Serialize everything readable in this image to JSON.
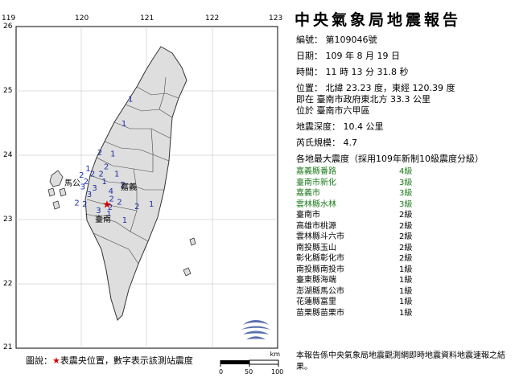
{
  "report": {
    "title": "中央氣象局地震報告",
    "number": "編號： 第109046號",
    "date": "日期： 109 年 8 月 19 日",
    "time": "時間： 11 時 13 分 31.8 秒",
    "position": "位置： 北緯 23.23 度，東經 120.39 度",
    "position_ref": "即在 臺南市政府東北方 33.3 公里",
    "position_district": "位於 臺南市六甲區",
    "depth": "地震深度： 10.4 公里",
    "magnitude": "芮氏規模： 4.7",
    "intensity_header": "各地最大震度（採用109年新制10級震度分級）"
  },
  "stations": [
    {
      "name": "嘉義縣番路",
      "level": "4級",
      "highlight": true
    },
    {
      "name": "臺南市新化",
      "level": "3級",
      "highlight": true
    },
    {
      "name": "嘉義市",
      "level": "3級",
      "highlight": true
    },
    {
      "name": "雲林縣水林",
      "level": "3級",
      "highlight": true
    },
    {
      "name": "臺南市",
      "level": "2級",
      "highlight": false
    },
    {
      "name": "高雄市桃源",
      "level": "2級",
      "highlight": false
    },
    {
      "name": "雲林縣斗六市",
      "level": "2級",
      "highlight": false
    },
    {
      "name": "南投縣玉山",
      "level": "2級",
      "highlight": false
    },
    {
      "name": "彰化縣彰化市",
      "level": "2級",
      "highlight": false
    },
    {
      "name": "南投縣南投市",
      "level": "1級",
      "highlight": false
    },
    {
      "name": "臺東縣海端",
      "level": "1級",
      "highlight": false
    },
    {
      "name": "澎湖縣馬公市",
      "level": "1級",
      "highlight": false
    },
    {
      "name": "花蓮縣富里",
      "level": "1級",
      "highlight": false
    },
    {
      "name": "苗栗縣苗栗市",
      "level": "1級",
      "highlight": false
    }
  ],
  "footer": "本報告係中央氣象局地震觀測網即時地震資料地震速報之結果。",
  "map": {
    "lon_ticks": [
      "119",
      "120",
      "121",
      "122",
      "123"
    ],
    "lat_ticks": [
      "26",
      "25",
      "24",
      "23",
      "22",
      "21"
    ],
    "legend_prefix": "圖說：",
    "legend_star": "★",
    "legend_suffix": "表震央位置，數字表示該測站震度",
    "scale_unit": "km",
    "scale_ticks": [
      "0",
      "50",
      "100"
    ],
    "epicenter": {
      "lon": 120.39,
      "lat": 23.23
    },
    "place_labels": [
      "馬公",
      "嘉義",
      "臺南"
    ],
    "intensity_marks": [
      {
        "v": "1",
        "lon": 120.75,
        "lat": 24.83
      },
      {
        "v": "1",
        "lon": 120.65,
        "lat": 24.45
      },
      {
        "v": "2",
        "lon": 120.28,
        "lat": 24.0
      },
      {
        "v": "1",
        "lon": 120.48,
        "lat": 23.98
      },
      {
        "v": "1",
        "lon": 120.1,
        "lat": 23.75
      },
      {
        "v": "2",
        "lon": 120.38,
        "lat": 23.78
      },
      {
        "v": "2",
        "lon": 120.0,
        "lat": 23.65
      },
      {
        "v": "2",
        "lon": 120.17,
        "lat": 23.67
      },
      {
        "v": "2",
        "lon": 120.3,
        "lat": 23.67
      },
      {
        "v": "1",
        "lon": 120.54,
        "lat": 23.67
      },
      {
        "v": "2",
        "lon": 120.07,
        "lat": 23.55
      },
      {
        "v": "1",
        "lon": 120.35,
        "lat": 23.55
      },
      {
        "v": "2",
        "lon": 120.63,
        "lat": 23.5
      },
      {
        "v": "3",
        "lon": 120.02,
        "lat": 23.47
      },
      {
        "v": "3",
        "lon": 120.2,
        "lat": 23.45
      },
      {
        "v": "4",
        "lon": 120.45,
        "lat": 23.4
      },
      {
        "v": "3",
        "lon": 120.12,
        "lat": 23.35
      },
      {
        "v": "2",
        "lon": 120.46,
        "lat": 23.28
      },
      {
        "v": "2",
        "lon": 120.58,
        "lat": 23.23
      },
      {
        "v": "2",
        "lon": 119.93,
        "lat": 23.22
      },
      {
        "v": "2",
        "lon": 120.05,
        "lat": 23.2
      },
      {
        "v": "2",
        "lon": 120.44,
        "lat": 23.15
      },
      {
        "v": "3",
        "lon": 120.26,
        "lat": 23.1
      },
      {
        "v": "1",
        "lon": 120.42,
        "lat": 23.05
      },
      {
        "v": "1",
        "lon": 121.07,
        "lat": 23.2
      },
      {
        "v": "2",
        "lon": 120.85,
        "lat": 23.16
      },
      {
        "v": "1",
        "lon": 120.66,
        "lat": 22.95
      }
    ]
  },
  "colors": {
    "station_highlight": "#1d7a1d",
    "epicenter": "#d40000",
    "land": "#d9d9d9",
    "sea": "#ffffff"
  }
}
